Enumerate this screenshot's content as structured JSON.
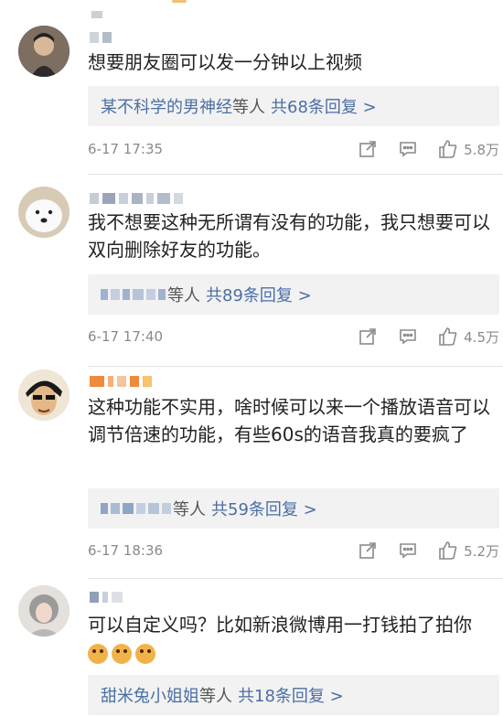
{
  "comments": [
    {
      "text": "想要朋友圈可以发一分钟以上视频",
      "reply_names": "某不科学的男神经",
      "reply_suffix": "等人",
      "reply_count": "共68条回复 >",
      "time": "6-17 17:35",
      "likes": "5.8万"
    },
    {
      "text": "我不想要这种无所谓有没有的功能，我只想要可以双向删除好友的功能。",
      "reply_names": "",
      "reply_suffix": "等人",
      "reply_count": "共89条回复 >",
      "time": "6-17 17:40",
      "likes": "4.5万"
    },
    {
      "text": "这种功能不实用，啥时候可以来一个播放语音可以调节倍速的功能，有些60s的语音我真的要疯了",
      "reply_names": "",
      "reply_suffix": "等人",
      "reply_count": "共59条回复 >",
      "time": "6-17 18:36",
      "likes": "5.2万"
    },
    {
      "text": "可以自定义吗？比如新浪微博用一打钱拍了拍你",
      "reply_names": "甜米兔小姐姐",
      "reply_suffix": "等人",
      "reply_count": "共18条回复 >",
      "time": "",
      "likes": ""
    }
  ],
  "colors": {
    "link": "#4a6fa5",
    "meta": "#8a8a8a",
    "reply_bg": "#f2f2f2"
  },
  "icons": [
    "share-icon",
    "comment-icon",
    "like-icon"
  ]
}
